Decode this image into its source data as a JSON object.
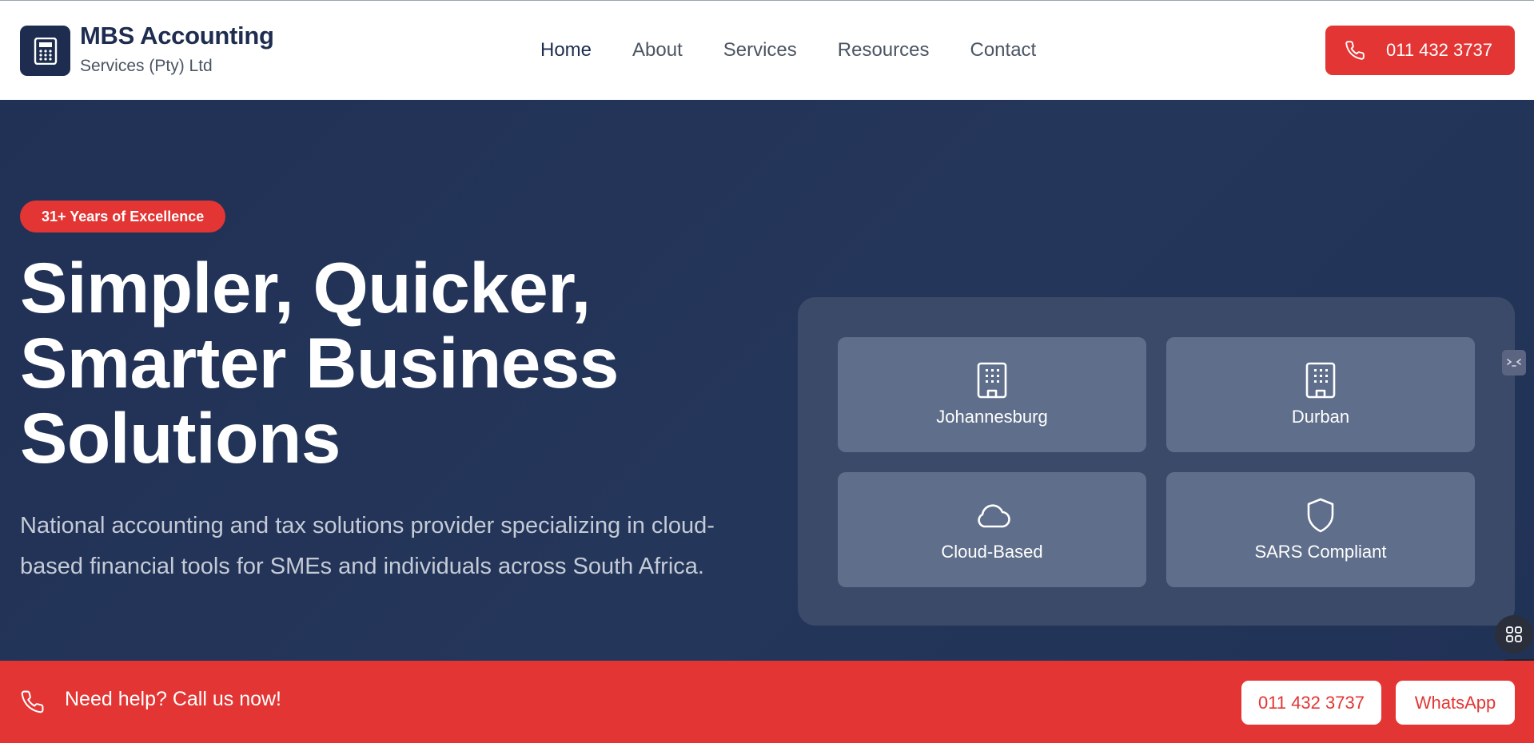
{
  "header": {
    "brand_name": "MBS Accounting",
    "brand_sub": "Services (Pty) Ltd",
    "logo_icon": "calculator-icon",
    "nav": [
      {
        "label": "Home",
        "active": true
      },
      {
        "label": "About",
        "active": false
      },
      {
        "label": "Services",
        "active": false
      },
      {
        "label": "Resources",
        "active": false
      },
      {
        "label": "Contact",
        "active": false
      }
    ],
    "call_button": {
      "label": "011 432 3737",
      "icon": "phone-icon"
    }
  },
  "hero": {
    "badge": "31+ Years of Excellence",
    "title_lines": [
      "Simpler, Quicker,",
      "Smarter Business",
      "Solutions"
    ],
    "description": "National accounting and tax solutions provider specializing in cloud-based financial tools for SMEs and individuals across South Africa.",
    "tiles": [
      {
        "label": "Johannesburg",
        "icon": "building-icon"
      },
      {
        "label": "Durban",
        "icon": "building-icon"
      },
      {
        "label": "Cloud-Based",
        "icon": "cloud-icon"
      },
      {
        "label": "SARS Compliant",
        "icon": "shield-icon"
      }
    ]
  },
  "bottom_bar": {
    "text": "Need help? Call us now!",
    "icon": "phone-icon",
    "phone_button": "011 432 3737",
    "whatsapp_button": "WhatsApp"
  },
  "colors": {
    "navy": "#1e2d4f",
    "hero_bg": "#24365a",
    "accent_red": "#e33533",
    "tile_bg": "#5f6e8a",
    "panel_bg": "#3b4a69"
  }
}
